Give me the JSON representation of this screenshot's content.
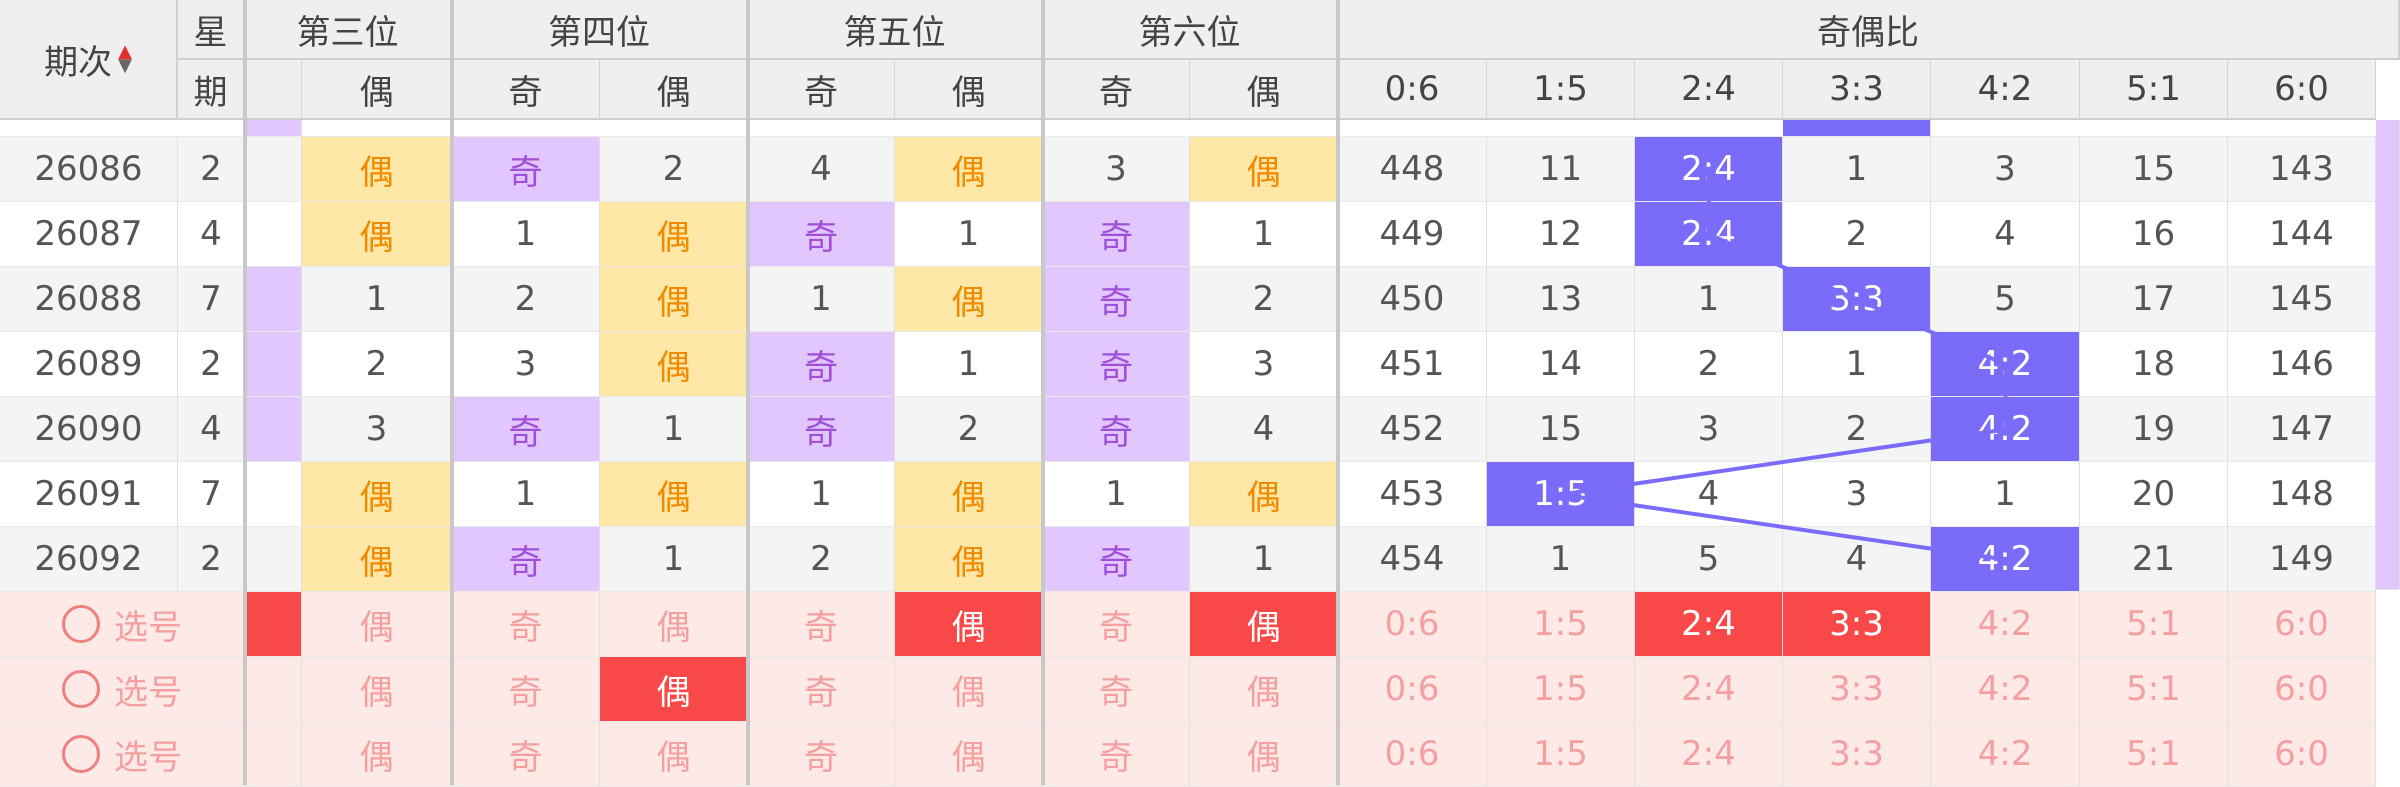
{
  "header": {
    "period": "期次",
    "week_top": "星",
    "week_bottom": "期",
    "groups": [
      "第三位",
      "第四位",
      "第五位",
      "第六位",
      "奇偶比"
    ],
    "sub": [
      "偶",
      "奇",
      "偶",
      "奇",
      "偶",
      "奇",
      "偶",
      "0:6",
      "1:5",
      "2:4",
      "3:3",
      "4:2",
      "5:1",
      "6:0"
    ]
  },
  "rows": [
    {
      "period": "26086",
      "week": "2",
      "cells": [
        "偶",
        "奇",
        "2",
        "4",
        "偶",
        "3",
        "偶",
        "448",
        "11",
        "2:4",
        "1",
        "3",
        "15",
        "143"
      ]
    },
    {
      "period": "26087",
      "week": "4",
      "cells": [
        "偶",
        "1",
        "偶",
        "奇",
        "1",
        "奇",
        "1",
        "449",
        "12",
        "2:4",
        "2",
        "4",
        "16",
        "144"
      ]
    },
    {
      "period": "26088",
      "week": "7",
      "cells": [
        "1",
        "2",
        "偶",
        "1",
        "偶",
        "奇",
        "2",
        "450",
        "13",
        "1",
        "3:3",
        "5",
        "17",
        "145"
      ]
    },
    {
      "period": "26089",
      "week": "2",
      "cells": [
        "2",
        "3",
        "偶",
        "奇",
        "1",
        "奇",
        "3",
        "451",
        "14",
        "2",
        "1",
        "4:2",
        "18",
        "146"
      ]
    },
    {
      "period": "26090",
      "week": "4",
      "cells": [
        "3",
        "奇",
        "1",
        "奇",
        "2",
        "奇",
        "4",
        "452",
        "15",
        "3",
        "2",
        "4:2",
        "19",
        "147"
      ]
    },
    {
      "period": "26091",
      "week": "7",
      "cells": [
        "偶",
        "1",
        "偶",
        "1",
        "偶",
        "1",
        "偶",
        "453",
        "1:5",
        "4",
        "3",
        "1",
        "20",
        "148"
      ]
    },
    {
      "period": "26092",
      "week": "2",
      "cells": [
        "偶",
        "奇",
        "1",
        "2",
        "偶",
        "奇",
        "1",
        "454",
        "1",
        "5",
        "4",
        "4:2",
        "21",
        "149"
      ]
    }
  ],
  "select_label": "选号",
  "select_cells": [
    "偶",
    "奇",
    "偶",
    "奇",
    "偶",
    "奇",
    "偶",
    "0:6",
    "1:5",
    "2:4",
    "3:3",
    "4:2",
    "5:1",
    "6:0"
  ],
  "colors": {
    "odd_bg": "#e2c7ff",
    "even_bg": "#ffe7a8",
    "ratio_bg": "#7a6cf8",
    "select_on": "#f84848"
  }
}
